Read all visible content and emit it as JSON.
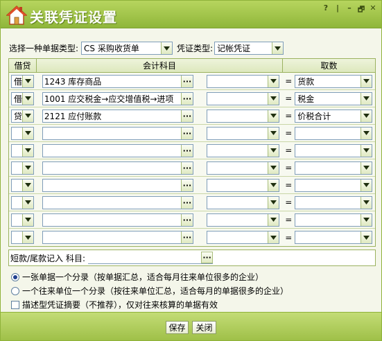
{
  "window": {
    "title": "关联凭证设置",
    "controls": [
      "?",
      "|",
      "–",
      "🗗",
      "✕"
    ]
  },
  "top": {
    "doc_type_label": "选择一种单据类型:",
    "doc_type_value": "CS 采购收货单",
    "voucher_type_label": "凭证类型:",
    "voucher_type_value": "记帐凭证"
  },
  "grid": {
    "headers": {
      "dc": "借贷",
      "account": "会计科目",
      "value": "取数"
    },
    "rows": [
      {
        "dc": "借",
        "account": "1243 库存商品",
        "value": "货款"
      },
      {
        "dc": "借",
        "account": "1001 应交税金→应交增值税→进项",
        "value": "税金"
      },
      {
        "dc": "贷",
        "account": "2121 应付账款",
        "value": "价税合计"
      },
      {
        "dc": "",
        "account": "",
        "value": ""
      },
      {
        "dc": "",
        "account": "",
        "value": ""
      },
      {
        "dc": "",
        "account": "",
        "value": ""
      },
      {
        "dc": "",
        "account": "",
        "value": ""
      },
      {
        "dc": "",
        "account": "",
        "value": ""
      },
      {
        "dc": "",
        "account": "",
        "value": ""
      },
      {
        "dc": "",
        "account": "",
        "value": ""
      }
    ],
    "eq": "="
  },
  "short": {
    "label": "短款/尾款记入",
    "account_label": "科目:"
  },
  "options": {
    "opt1": "一张单据一个分录（按单据汇总，适合每月往来单位很多的企业）",
    "opt2": "一个往来单位一个分录（按往来单位汇总，适合每月的单据很多的企业）",
    "opt3": "描述型凭证摘要（不推荐），仅对往来核算的单据有效"
  },
  "buttons": {
    "save": "保存",
    "close": "关闭"
  },
  "dots": "···"
}
